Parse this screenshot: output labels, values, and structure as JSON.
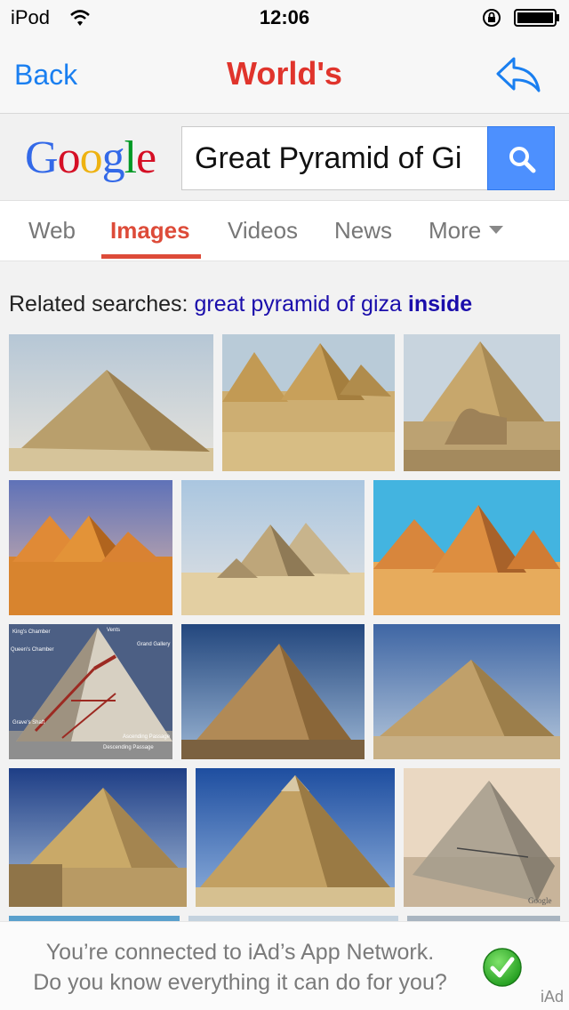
{
  "status_bar": {
    "carrier": "iPod",
    "time": "12:06"
  },
  "nav": {
    "back_label": "Back",
    "title": "World's"
  },
  "search": {
    "logo": [
      "G",
      "o",
      "o",
      "g",
      "l",
      "e"
    ],
    "logo_colors": [
      "#3369e8",
      "#d50f25",
      "#eeb211",
      "#3369e8",
      "#009925",
      "#d50f25"
    ],
    "query": "Great Pyramid of Gi"
  },
  "tabs": [
    {
      "label": "Web"
    },
    {
      "label": "Images"
    },
    {
      "label": "Videos"
    },
    {
      "label": "News"
    },
    {
      "label": "More"
    }
  ],
  "active_tab": "Images",
  "related": {
    "prefix": "Related searches:",
    "link_text": "great pyramid of giza",
    "link_bold": "inside"
  },
  "images": [
    {
      "subject": "pyramid desert photo"
    },
    {
      "subject": "pyramids of giza"
    },
    {
      "subject": "pyramid with sphinx"
    },
    {
      "subject": "pyramids at sunset"
    },
    {
      "subject": "giza pyramid complex"
    },
    {
      "subject": "pyramids blue sky"
    },
    {
      "subject": "pyramid cross-section diagram",
      "labels": [
        "King's Chamber",
        "Vents",
        "Grand Gallery",
        "Queen's Chamber",
        "Grave's Shaft",
        "Ascending Passage",
        "Descending Passage"
      ]
    },
    {
      "subject": "pyramid closeup"
    },
    {
      "subject": "pyramid dusk"
    },
    {
      "subject": "pyramid and ruins"
    },
    {
      "subject": "khafre pyramid"
    },
    {
      "subject": "pyramid 3d model",
      "watermark": "Google"
    }
  ],
  "ad": {
    "line1": "You’re connected to iAd’s App Network.",
    "line2": "Do you know everything it can do for you?",
    "label": "iAd"
  },
  "colors": {
    "accent": "#1a7ff0",
    "title": "#e0342c",
    "search_button": "#4d90fe",
    "active_tab": "#dd4b39",
    "link": "#1a0dab"
  }
}
